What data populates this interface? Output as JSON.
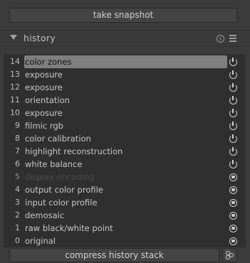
{
  "snapshot": {
    "label": "take snapshot"
  },
  "module": {
    "title": "history",
    "reset_icon": "reset-icon",
    "presets_icon": "presets-icon"
  },
  "history": [
    {
      "num": "14",
      "label": "color zones",
      "state": "power",
      "selected": true,
      "disabled": false
    },
    {
      "num": "13",
      "label": "exposure",
      "state": "power",
      "selected": false,
      "disabled": false
    },
    {
      "num": "12",
      "label": "exposure",
      "state": "power",
      "selected": false,
      "disabled": false
    },
    {
      "num": "11",
      "label": "orientation",
      "state": "power",
      "selected": false,
      "disabled": false
    },
    {
      "num": "10",
      "label": "exposure",
      "state": "power",
      "selected": false,
      "disabled": false
    },
    {
      "num": "9",
      "label": "filmic rgb",
      "state": "power",
      "selected": false,
      "disabled": false
    },
    {
      "num": "8",
      "label": "color calibration",
      "state": "power",
      "selected": false,
      "disabled": false
    },
    {
      "num": "7",
      "label": "highlight reconstruction",
      "state": "power",
      "selected": false,
      "disabled": false
    },
    {
      "num": "6",
      "label": "white balance",
      "state": "power",
      "selected": false,
      "disabled": false
    },
    {
      "num": "5",
      "label": "display encoding",
      "state": "always",
      "selected": false,
      "disabled": true
    },
    {
      "num": "4",
      "label": "output color profile",
      "state": "always",
      "selected": false,
      "disabled": false
    },
    {
      "num": "3",
      "label": "input color profile",
      "state": "always",
      "selected": false,
      "disabled": false
    },
    {
      "num": "2",
      "label": "demosaic",
      "state": "always",
      "selected": false,
      "disabled": false
    },
    {
      "num": "1",
      "label": "raw black/white point",
      "state": "always",
      "selected": false,
      "disabled": false
    },
    {
      "num": "0",
      "label": "original",
      "state": "always",
      "selected": false,
      "disabled": false
    }
  ],
  "compress": {
    "label": "compress history stack"
  },
  "truncate_icon": "truncate-icon"
}
